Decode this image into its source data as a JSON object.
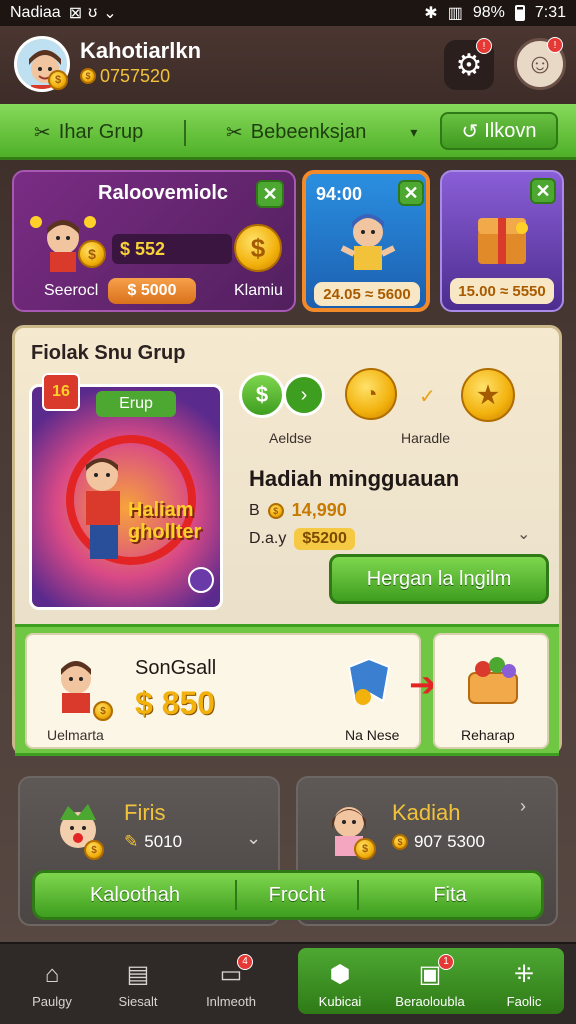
{
  "status_bar": {
    "carrier": "Nadiaa",
    "battery": "98%",
    "time": "7:31"
  },
  "header": {
    "username": "Kahotiarlkn",
    "balance": "0757520"
  },
  "tabs": {
    "tab1": "Ihar Grup",
    "tab2": "Bebeenksjan",
    "button": "Ilkovn"
  },
  "promo": {
    "card1": {
      "title": "Raloovemiolc",
      "amount": "$ 552",
      "footer_left": "Seerocl",
      "footer_pill": "$ 5000",
      "footer_right": "Klamiu"
    },
    "card2": {
      "top_label": "94:00",
      "price": "24.05 ≈ 5600"
    },
    "card3": {
      "price": "15.00 ≈ 5550"
    }
  },
  "group": {
    "title": "Fiolak Snu Grup",
    "tag": "Erup",
    "icon_label_left": "Aeldse",
    "icon_label_right": "Haradle",
    "prize_title": "Hadiah mingguauan",
    "row1_label": "B",
    "row1_value": "14,990",
    "row2_label": "D.a.y",
    "row2_value": "$5200",
    "image_caption_line1": "Haliam",
    "image_caption_line2": "ghollter",
    "action_button": "Hergan la lngilm"
  },
  "reward_strip": {
    "name": "SonGsall",
    "amount": "$ 850",
    "footer_left": "Uelmarta",
    "middle_label": "Na Nese",
    "right_label": "Reharap"
  },
  "low_cards": {
    "left": {
      "title": "Firis",
      "value": "5010"
    },
    "right": {
      "title": "Kadiah",
      "value": "907 5300"
    }
  },
  "action_bar": {
    "btn1": "Kaloothah",
    "btn2": "Frocht",
    "btn3": "Fita"
  },
  "nav": {
    "items": [
      "Paulgy",
      "Siesalt",
      "Inlmeoth",
      "Kubicai",
      "Beraoloubla",
      "Faolic"
    ],
    "badge_2": "4",
    "badge_4": "1"
  }
}
